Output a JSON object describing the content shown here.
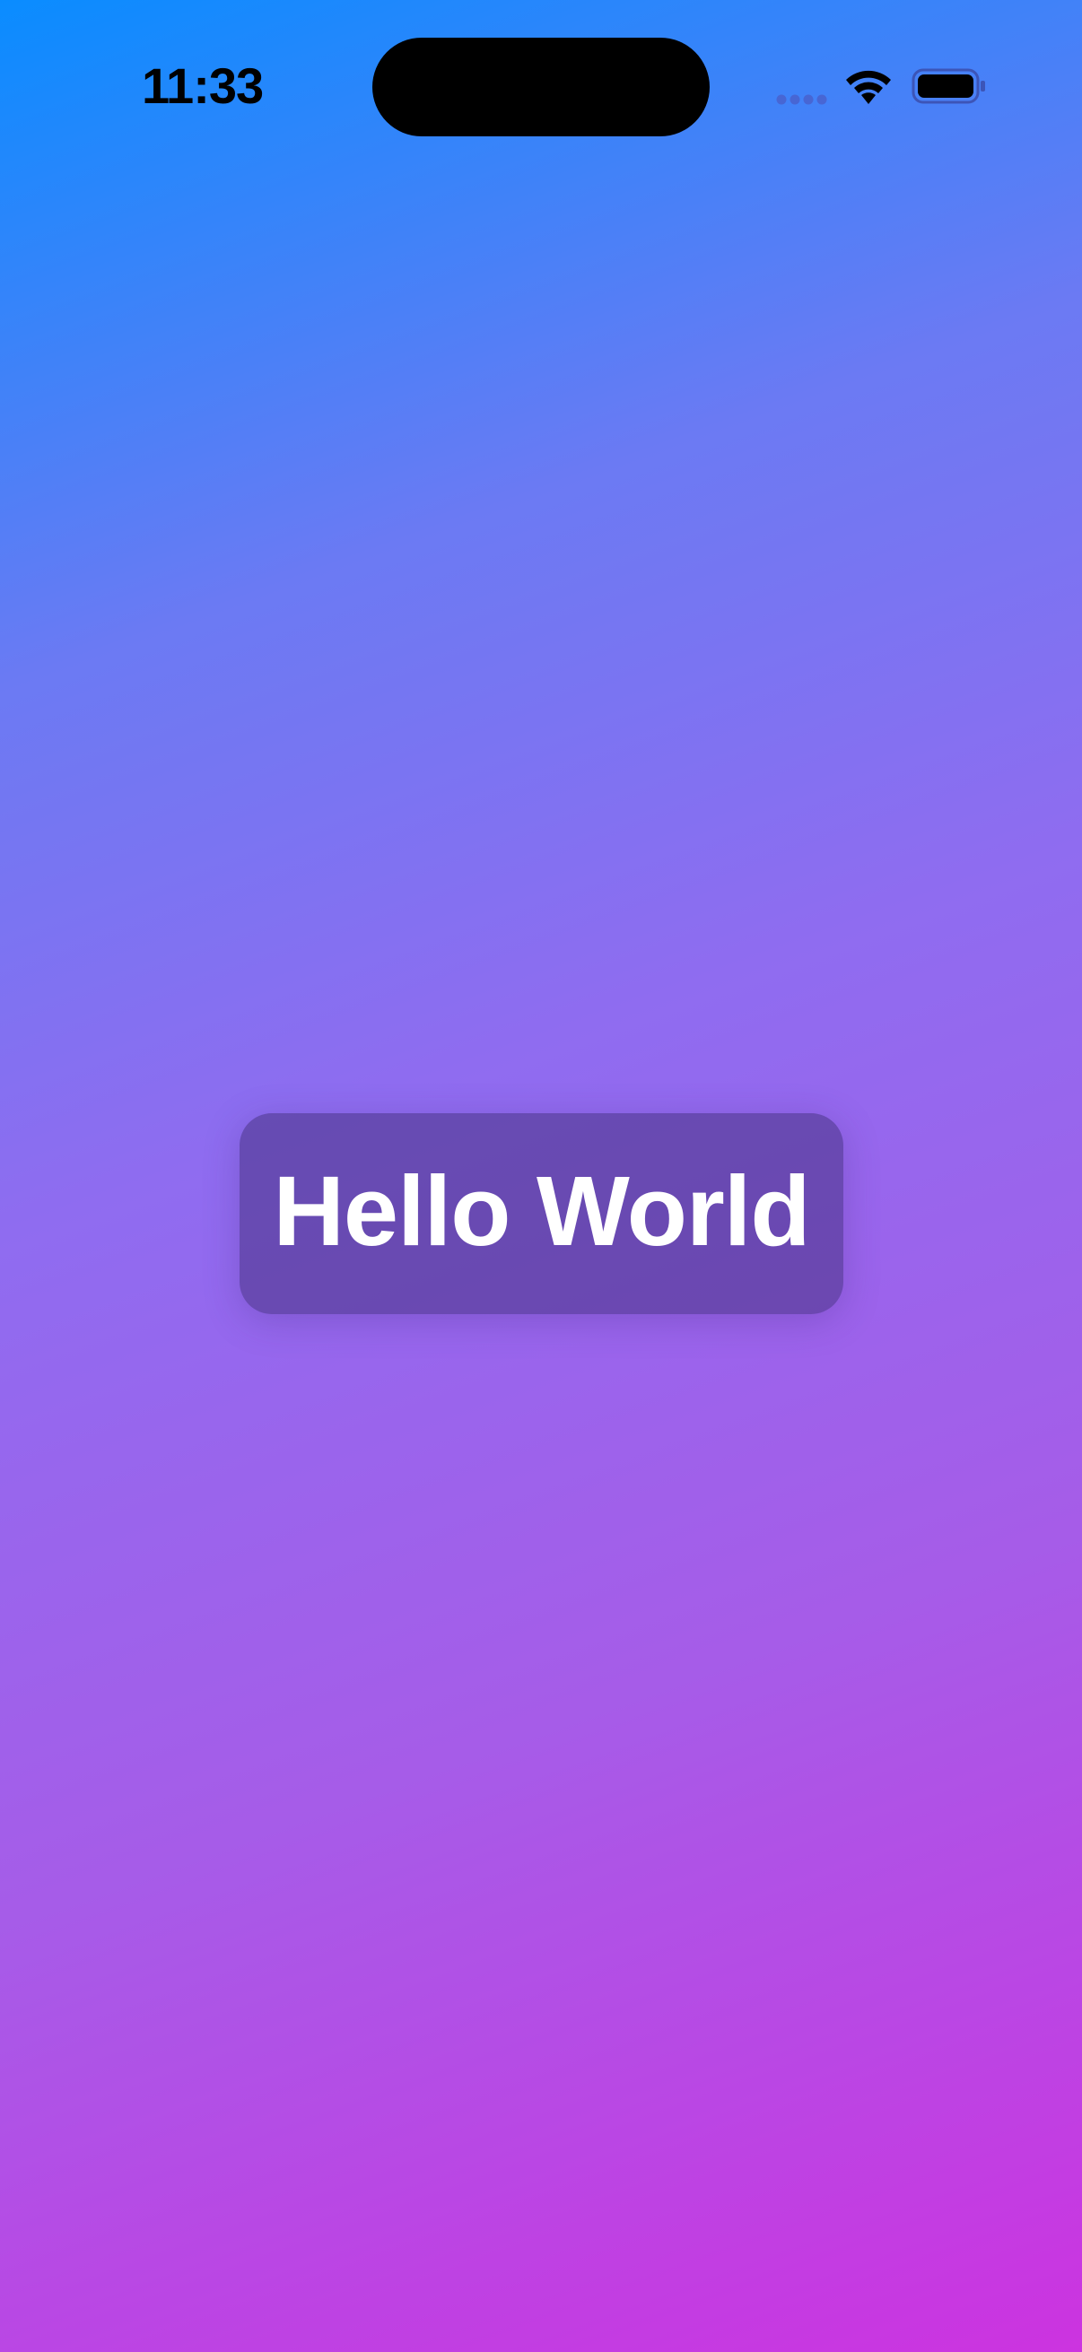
{
  "status_bar": {
    "time": "11:33",
    "icons": [
      "cellular-signal-icon",
      "wifi-icon",
      "battery-icon"
    ]
  },
  "main": {
    "greeting": "Hello World"
  },
  "colors": {
    "gradient_start": "#0a8cff",
    "gradient_end": "#cc33e0",
    "card_background": "#463282",
    "text": "#ffffff"
  }
}
